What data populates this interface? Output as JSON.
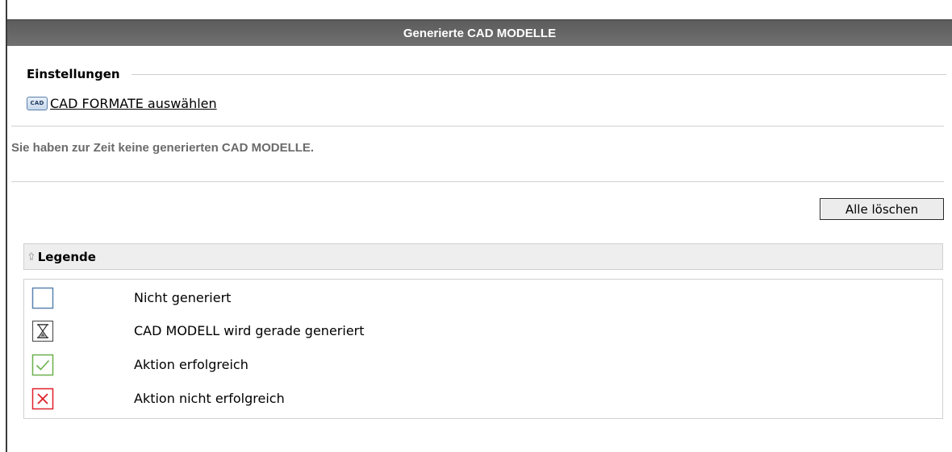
{
  "header": {
    "title": "Generierte CAD MODELLE"
  },
  "settings": {
    "heading": "Einstellungen",
    "cad_icon_text": "CAD",
    "cad_formats_link": "CAD FORMATE auswählen"
  },
  "info": {
    "message": "Sie haben zur Zeit keine generierten CAD MODELLE."
  },
  "actions": {
    "delete_all_label": "Alle löschen"
  },
  "legend": {
    "title": "Legende",
    "collapse_icon": "collapse-up-icon",
    "items": [
      {
        "icon": "empty-square-icon",
        "label": "Nicht generiert",
        "color": "#5b84b0"
      },
      {
        "icon": "hourglass-icon",
        "label": "CAD MODELL wird gerade generiert",
        "color": "#333333"
      },
      {
        "icon": "checkmark-icon",
        "label": "Aktion erfolgreich",
        "color": "#6ab04c"
      },
      {
        "icon": "error-cross-icon",
        "label": "Aktion nicht erfolgreich",
        "color": "#e0202a"
      }
    ]
  },
  "colors": {
    "title_bar": "#666666",
    "info_text": "#6b6b6b",
    "legend_header_bg": "#eeeeee"
  }
}
